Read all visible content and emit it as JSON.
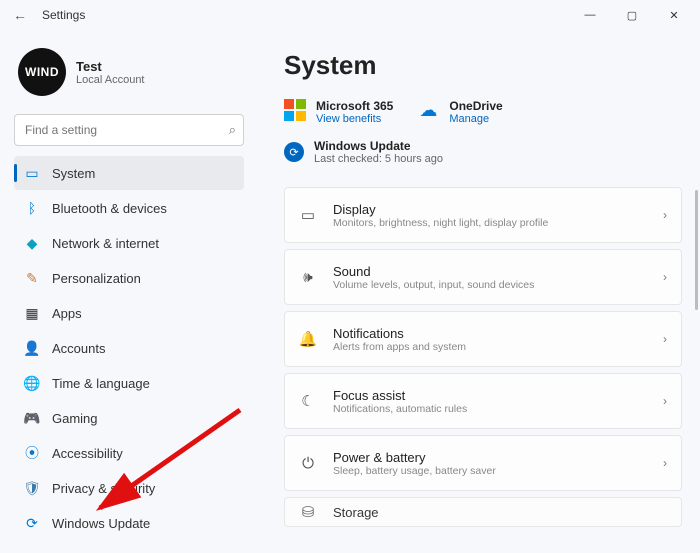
{
  "titlebar": {
    "title": "Settings"
  },
  "user": {
    "avatar_text": "WIND",
    "name": "Test",
    "sub": "Local Account"
  },
  "search": {
    "placeholder": "Find a setting"
  },
  "nav": {
    "system": "System",
    "bluetooth": "Bluetooth & devices",
    "network": "Network & internet",
    "personalization": "Personalization",
    "apps": "Apps",
    "accounts": "Accounts",
    "time": "Time & language",
    "gaming": "Gaming",
    "accessibility": "Accessibility",
    "privacy": "Privacy & security",
    "update": "Windows Update"
  },
  "page": {
    "title": "System"
  },
  "status": {
    "ms365": {
      "title": "Microsoft 365",
      "sub": "View benefits"
    },
    "onedrive": {
      "title": "OneDrive",
      "sub": "Manage"
    },
    "update": {
      "title": "Windows Update",
      "sub": "Last checked: 5 hours ago"
    }
  },
  "cards": {
    "display": {
      "title": "Display",
      "sub": "Monitors, brightness, night light, display profile"
    },
    "sound": {
      "title": "Sound",
      "sub": "Volume levels, output, input, sound devices"
    },
    "notifications": {
      "title": "Notifications",
      "sub": "Alerts from apps and system"
    },
    "focus": {
      "title": "Focus assist",
      "sub": "Notifications, automatic rules"
    },
    "power": {
      "title": "Power & battery",
      "sub": "Sleep, battery usage, battery saver"
    },
    "storage": {
      "title": "Storage",
      "sub": ""
    }
  }
}
